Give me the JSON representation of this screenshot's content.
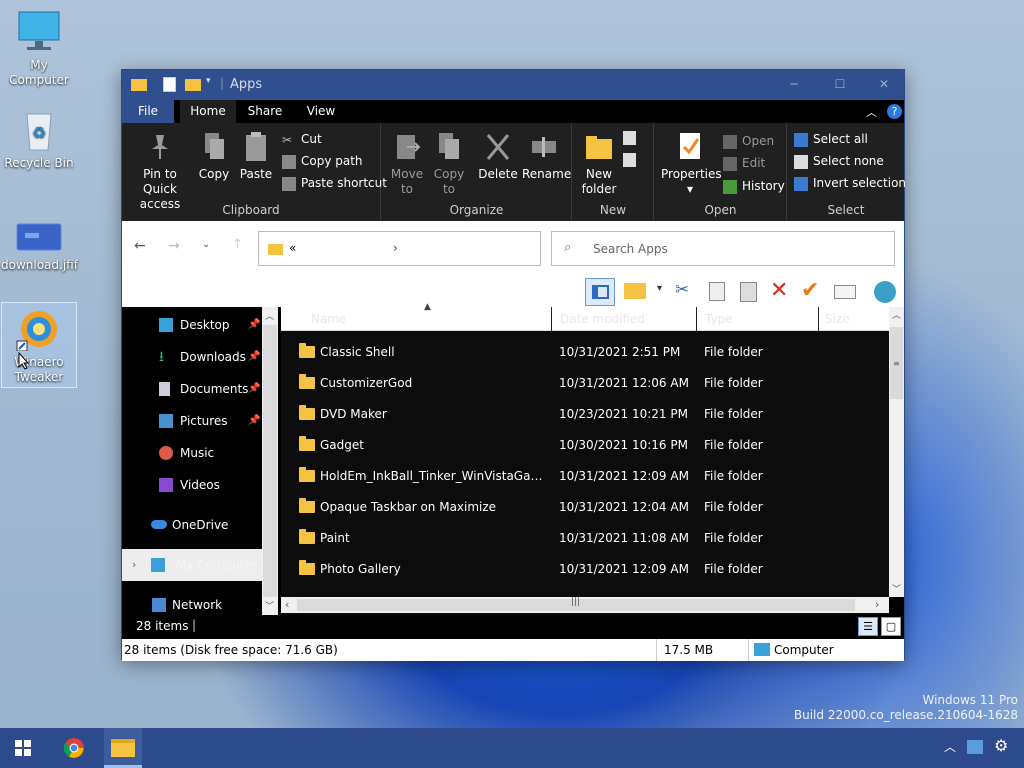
{
  "desktop": {
    "icons": [
      {
        "label1": "My",
        "label2": "Computer",
        "icon": "computer-icon"
      },
      {
        "label1": "Recycle Bin",
        "label2": "",
        "icon": "recycle-bin-icon"
      },
      {
        "label1": "download.jfif",
        "label2": "",
        "icon": "image-file-icon"
      },
      {
        "label1": "Winaero",
        "label2": "Tweaker",
        "icon": "winaero-tweaker-icon"
      }
    ],
    "watermark_line1": "Windows 11 Pro",
    "watermark_line2": "Build 22000.co_release.210604-1628"
  },
  "window": {
    "title": "Apps",
    "menu_tabs": {
      "file": "File",
      "home": "Home",
      "share": "Share",
      "view": "View"
    },
    "ribbon": {
      "clipboard": {
        "pin_line1": "Pin to Quick",
        "pin_line2": "access",
        "copy": "Copy",
        "paste": "Paste",
        "cut": "Cut",
        "copy_path": "Copy path",
        "paste_shortcut": "Paste shortcut",
        "group": "Clipboard"
      },
      "organize": {
        "move_line1": "Move",
        "move_line2": "to",
        "copy_line1": "Copy",
        "copy_line2": "to",
        "delete": "Delete",
        "rename": "Rename",
        "group": "Organize"
      },
      "new": {
        "folder_line1": "New",
        "folder_line2": "folder",
        "group": "New"
      },
      "open": {
        "properties": "Properties",
        "open": "Open",
        "edit": "Edit",
        "history": "History",
        "group": "Open"
      },
      "select": {
        "select_all": "Select all",
        "select_none": "Select none",
        "invert": "Invert selection",
        "group": "Select"
      }
    },
    "address": {
      "path_prefix": "«",
      "search_placeholder": "Search Apps"
    },
    "columns": {
      "name": "Name",
      "date": "Date modified",
      "type": "Type",
      "size": "Size"
    },
    "nav": {
      "items": [
        {
          "label": "Desktop",
          "icon": "desktop-icon",
          "pinned": true
        },
        {
          "label": "Downloads",
          "icon": "downloads-icon",
          "pinned": true
        },
        {
          "label": "Documents",
          "icon": "documents-icon",
          "pinned": true
        },
        {
          "label": "Pictures",
          "icon": "pictures-icon",
          "pinned": true
        },
        {
          "label": "Music",
          "icon": "music-icon",
          "pinned": false
        },
        {
          "label": "Videos",
          "icon": "videos-icon",
          "pinned": false
        },
        {
          "label": "OneDrive",
          "icon": "onedrive-icon",
          "pinned": false
        },
        {
          "label": "My Computer",
          "icon": "computer-icon",
          "pinned": false
        },
        {
          "label": "Network",
          "icon": "network-icon",
          "pinned": false
        }
      ]
    },
    "files": [
      {
        "name": "Classic Shell",
        "date": "10/31/2021 2:51 PM",
        "type": "File folder"
      },
      {
        "name": "CustomizerGod",
        "date": "10/31/2021 12:06 AM",
        "type": "File folder"
      },
      {
        "name": "DVD Maker",
        "date": "10/23/2021 10:21 PM",
        "type": "File folder"
      },
      {
        "name": "Gadget",
        "date": "10/30/2021 10:16 PM",
        "type": "File folder"
      },
      {
        "name": "HoldEm_InkBall_Tinker_WinVistaGames_...",
        "date": "10/31/2021 12:09 AM",
        "type": "File folder"
      },
      {
        "name": "Opaque Taskbar on Maximize",
        "date": "10/31/2021 12:04 AM",
        "type": "File folder"
      },
      {
        "name": "Paint",
        "date": "10/31/2021 11:08 AM",
        "type": "File folder"
      },
      {
        "name": "Photo Gallery",
        "date": "10/31/2021 12:09 AM",
        "type": "File folder"
      }
    ],
    "status": {
      "items": "28 items",
      "details": "28 items (Disk free space: 71.6 GB)",
      "size": "17.5 MB",
      "location": "Computer"
    }
  },
  "colors": {
    "titlebar": "#2f4f8f",
    "ribbon_bg": "#202020",
    "folder": "#f5c342",
    "taskbar": "#2d4a8c"
  }
}
